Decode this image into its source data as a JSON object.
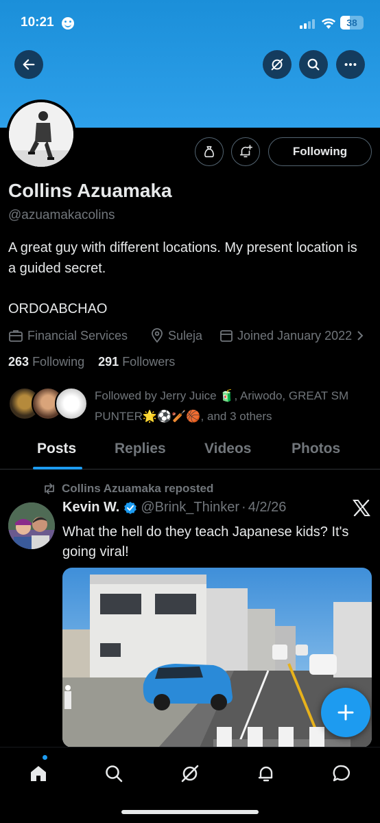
{
  "status_bar": {
    "time": "10:21",
    "battery": "38"
  },
  "profile": {
    "name": "Collins Azuamaka",
    "handle": "@azuamakacolins",
    "bio": "A great guy with different locations. My present location is a guided secret.",
    "bio_extra": "ORDOABCHAO",
    "category": "Financial Services",
    "location": "Suleja",
    "joined": "Joined January 2022",
    "following_count": "263",
    "following_label": "Following",
    "followers_count": "291",
    "followers_label": "Followers",
    "followed_by": "Followed by Jerry Juice 🧃, Ariwodo, GREAT SM PUNTER🌟⚽🏏🏀, and 3 others"
  },
  "actions": {
    "following_button": "Following"
  },
  "tabs": [
    {
      "label": "Posts",
      "active": true
    },
    {
      "label": "Replies",
      "active": false
    },
    {
      "label": "Videos",
      "active": false
    },
    {
      "label": "Photos",
      "active": false
    }
  ],
  "post": {
    "repost_label": "Collins Azuamaka reposted",
    "author_name": "Kevin W.",
    "author_handle": "@Brink_Thinker",
    "separator": "·",
    "date": "4/2/26",
    "text": "What the hell do they teach Japanese kids? It's going viral!"
  },
  "icons": {
    "back": "arrow-left-icon",
    "grok": "grok-icon",
    "search": "search-icon",
    "more": "more-icon",
    "tip": "money-bag-icon",
    "notify": "bell-plus-icon",
    "verified": "verified-badge-icon",
    "compose": "plus-icon"
  },
  "colors": {
    "accent": "#1d9bf0",
    "banner": "#2ea0ea",
    "muted": "#71767b",
    "text": "#e7e9ea"
  }
}
